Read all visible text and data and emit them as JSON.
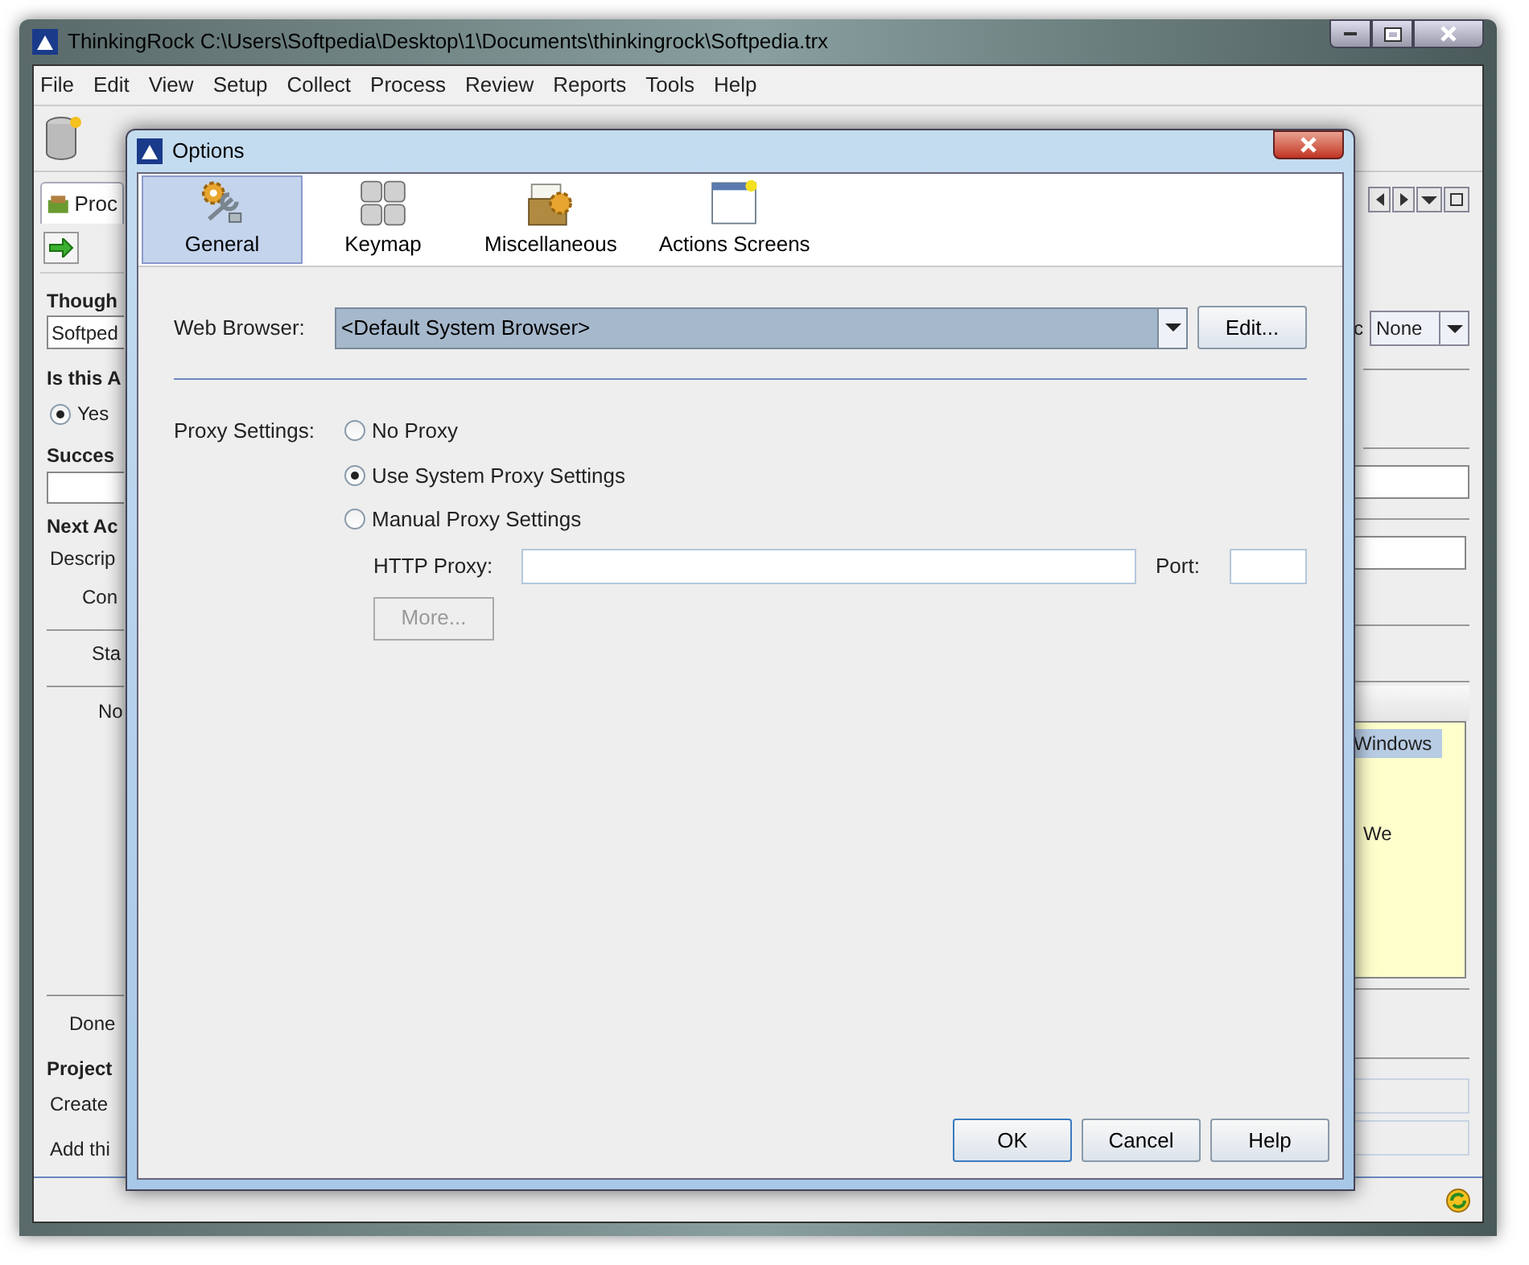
{
  "main_window": {
    "title": "ThinkingRock C:\\Users\\Softpedia\\Desktop\\1\\Documents\\thinkingrock\\Softpedia.trx",
    "menu": [
      {
        "label": "File"
      },
      {
        "label": "Edit"
      },
      {
        "label": "View"
      },
      {
        "label": "Setup"
      },
      {
        "label": "Collect"
      },
      {
        "label": "Process"
      },
      {
        "label": "Review"
      },
      {
        "label": "Reports"
      },
      {
        "label": "Tools"
      },
      {
        "label": "Help"
      }
    ],
    "tab": {
      "label": "Proc",
      "selected": true
    },
    "left": {
      "thought_heading": "Though",
      "thought_value": "Softped",
      "actionable_heading": "Is this A",
      "yes_option": {
        "label": "Yes",
        "selected": true
      },
      "success_heading": "Succes",
      "next_heading": "Next Ac",
      "description_label": "Descrip",
      "context_label": "Con",
      "start_label": "Sta",
      "notes_label": "No",
      "done_label": "Done",
      "project_heading": "Project",
      "create_label": "Create",
      "add_label": "Add thi"
    },
    "right": {
      "label_fragment": "c",
      "dropdown_value": "None",
      "note_highlight": "Windows",
      "note_text": "We"
    }
  },
  "dialog": {
    "title": "Options",
    "categories": [
      {
        "label": "General",
        "selected": true
      },
      {
        "label": "Keymap",
        "selected": false
      },
      {
        "label": "Miscellaneous",
        "selected": false
      },
      {
        "label": "Actions Screens",
        "selected": false
      }
    ],
    "web_browser": {
      "label": "Web Browser:",
      "value": "<Default System Browser>",
      "edit_button": {
        "label": "Edit..."
      }
    },
    "proxy": {
      "label": "Proxy Settings:",
      "options": [
        {
          "label": "No Proxy",
          "selected": false
        },
        {
          "label": "Use System Proxy Settings",
          "selected": true
        },
        {
          "label": "Manual Proxy Settings",
          "selected": false
        }
      ],
      "http_proxy": {
        "label": "HTTP Proxy:"
      },
      "port": {
        "label": "Port:"
      },
      "more_button": {
        "label": "More...",
        "disabled": true
      }
    },
    "buttons": [
      {
        "label": "OK",
        "default": true
      },
      {
        "label": "Cancel",
        "default": false
      },
      {
        "label": "Help",
        "default": false
      }
    ]
  }
}
